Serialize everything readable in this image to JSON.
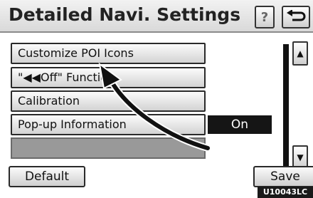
{
  "header": {
    "title": "Detailed Navi. Settings",
    "help_label": "?"
  },
  "menu": {
    "items": [
      {
        "label": "Customize POI Icons"
      },
      {
        "label": "\"◀◀Off\" Function"
      },
      {
        "label": "Calibration"
      },
      {
        "label": "Pop-up Information"
      }
    ],
    "popup_value": "On"
  },
  "footer": {
    "default_label": "Default",
    "save_label": "Save"
  },
  "image_code": "U10043LC",
  "icons": {
    "back": "return-icon",
    "scroll_up": "scroll-up-icon",
    "scroll_down": "scroll-down-icon",
    "pointer": "curved-arrow-icon"
  }
}
